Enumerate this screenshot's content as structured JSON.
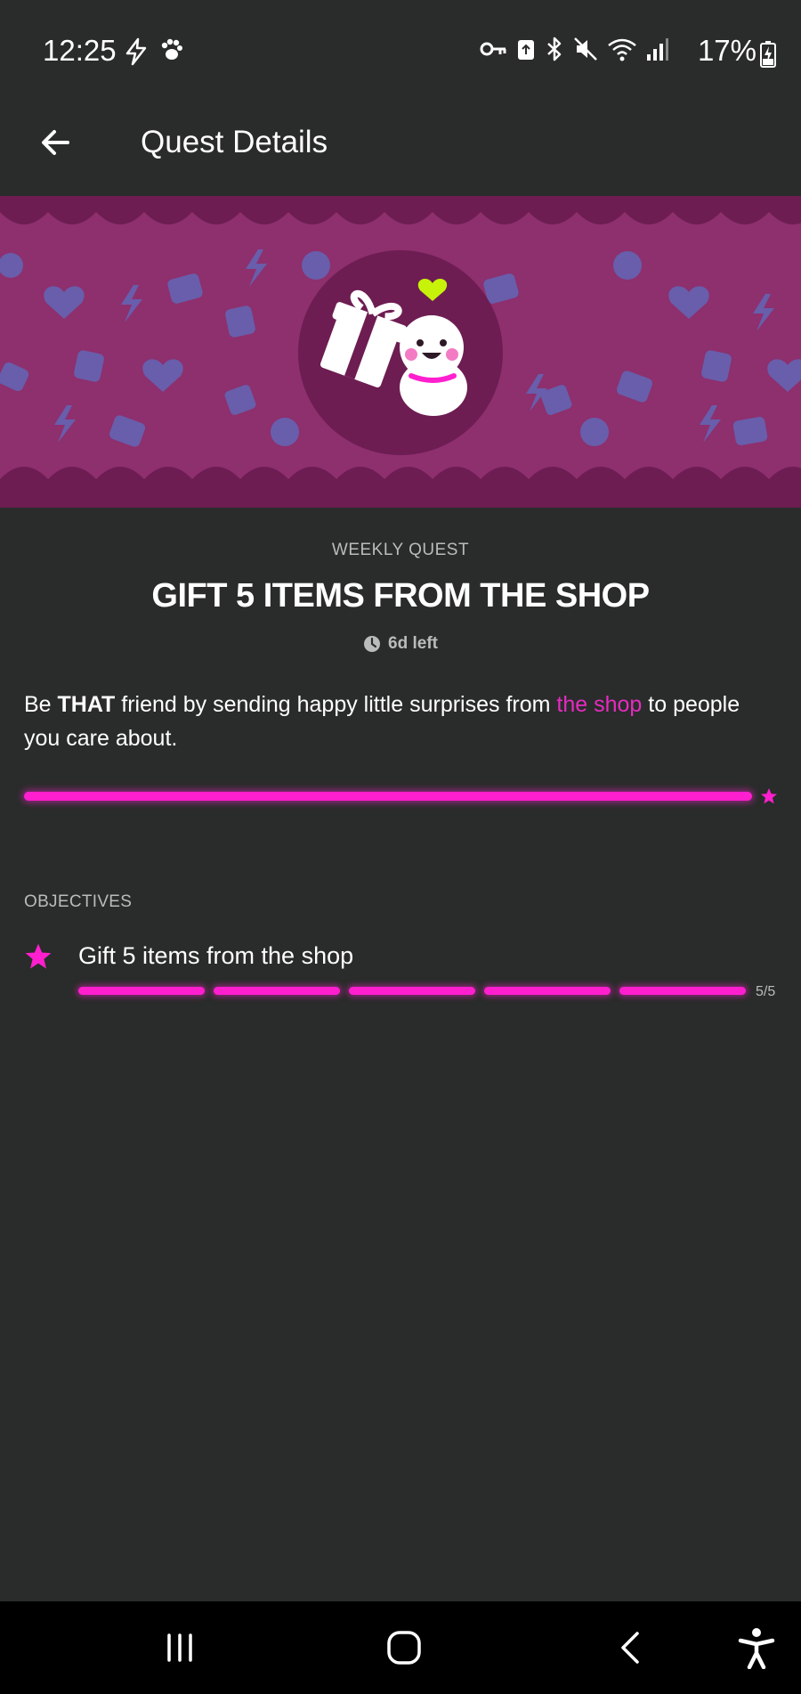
{
  "status_bar": {
    "time": "12:25",
    "battery": "17%",
    "icons_left": [
      "flash-icon",
      "paw-icon"
    ],
    "icons_right": [
      "key-icon",
      "lock-icon",
      "bluetooth-icon",
      "mute-icon",
      "wifi-icon",
      "signal-icon"
    ]
  },
  "app_bar": {
    "title": "Quest Details",
    "back_icon": "arrow-left-icon"
  },
  "quest": {
    "type": "WEEKLY QUEST",
    "title": "GIFT 5 ITEMS FROM THE SHOP",
    "time_left": "6d left",
    "description": {
      "part1": "Be ",
      "bold": "THAT",
      "part2": " friend by sending happy little surprises from ",
      "link": "the shop",
      "part3": " to people you care about."
    },
    "progress": 1.0
  },
  "objectives": {
    "header": "OBJECTIVES",
    "items": [
      {
        "label": "Gift 5 items from the shop",
        "completed": 5,
        "total": 5,
        "count_text": "5/5"
      }
    ]
  },
  "colors": {
    "accent": "#ff1fcf",
    "background": "#292c2a",
    "banner": "#8e2f6e",
    "muted_text": "#b9bcba"
  }
}
